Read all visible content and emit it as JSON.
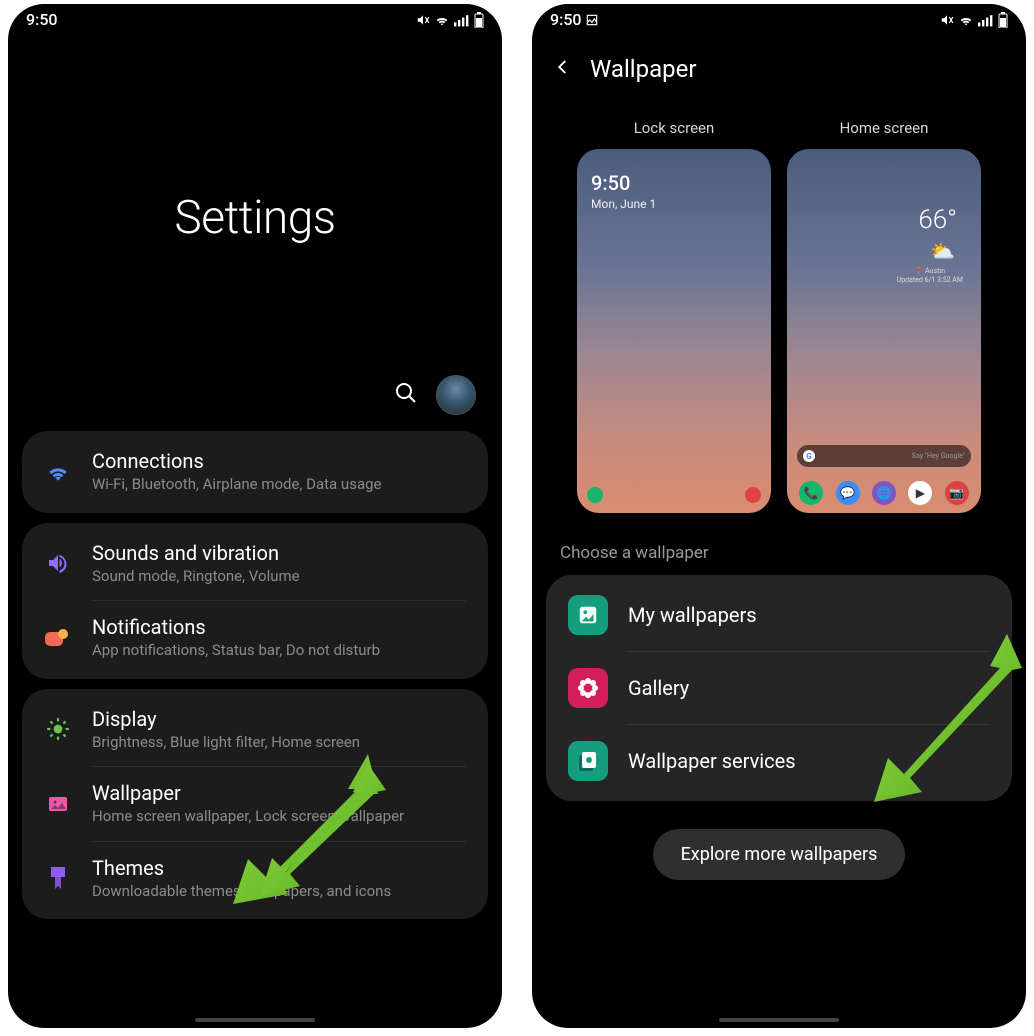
{
  "status": {
    "time": "9:50",
    "icons": "⠀"
  },
  "left": {
    "title": "Settings",
    "groups": [
      {
        "items": [
          {
            "icon": "wifi",
            "color": "#4e8cff",
            "title": "Connections",
            "sub": "Wi-Fi, Bluetooth, Airplane mode, Data usage"
          }
        ]
      },
      {
        "items": [
          {
            "icon": "sound",
            "color": "#8e6cff",
            "title": "Sounds and vibration",
            "sub": "Sound mode, Ringtone, Volume"
          },
          {
            "icon": "notif",
            "color": "#f06b55",
            "title": "Notifications",
            "sub": "App notifications, Status bar, Do not disturb"
          }
        ]
      },
      {
        "items": [
          {
            "icon": "sun",
            "color": "#6bc24a",
            "title": "Display",
            "sub": "Brightness, Blue light filter, Home screen"
          },
          {
            "icon": "wallpaper",
            "color": "#e85aa5",
            "title": "Wallpaper",
            "sub": "Home screen wallpaper, Lock screen wallpaper"
          },
          {
            "icon": "themes",
            "color": "#9259ff",
            "title": "Themes",
            "sub": "Downloadable themes, wallpapers, and icons"
          }
        ]
      }
    ]
  },
  "right": {
    "header": "Wallpaper",
    "previews": {
      "lock": {
        "label": "Lock screen",
        "time": "9:50",
        "date": "Mon, June 1"
      },
      "home": {
        "label": "Home screen",
        "temp": "66°",
        "city": "Austin",
        "updated": "Updated 6/1 3:52 AM",
        "search_hint": "Say \"Hey Google\"",
        "dock_colors": [
          "#18b66b",
          "#3a8dff",
          "#7e57c2",
          "#ffffff",
          "#e04242"
        ]
      }
    },
    "section_label": "Choose a wallpaper",
    "wp_items": [
      {
        "icon": "image",
        "bg": "#159e7e",
        "title": "My wallpapers"
      },
      {
        "icon": "flower",
        "bg": "#d31e5c",
        "title": "Gallery"
      },
      {
        "icon": "services",
        "bg": "#159e7e",
        "title": "Wallpaper services"
      }
    ],
    "explore": "Explore more wallpapers"
  }
}
